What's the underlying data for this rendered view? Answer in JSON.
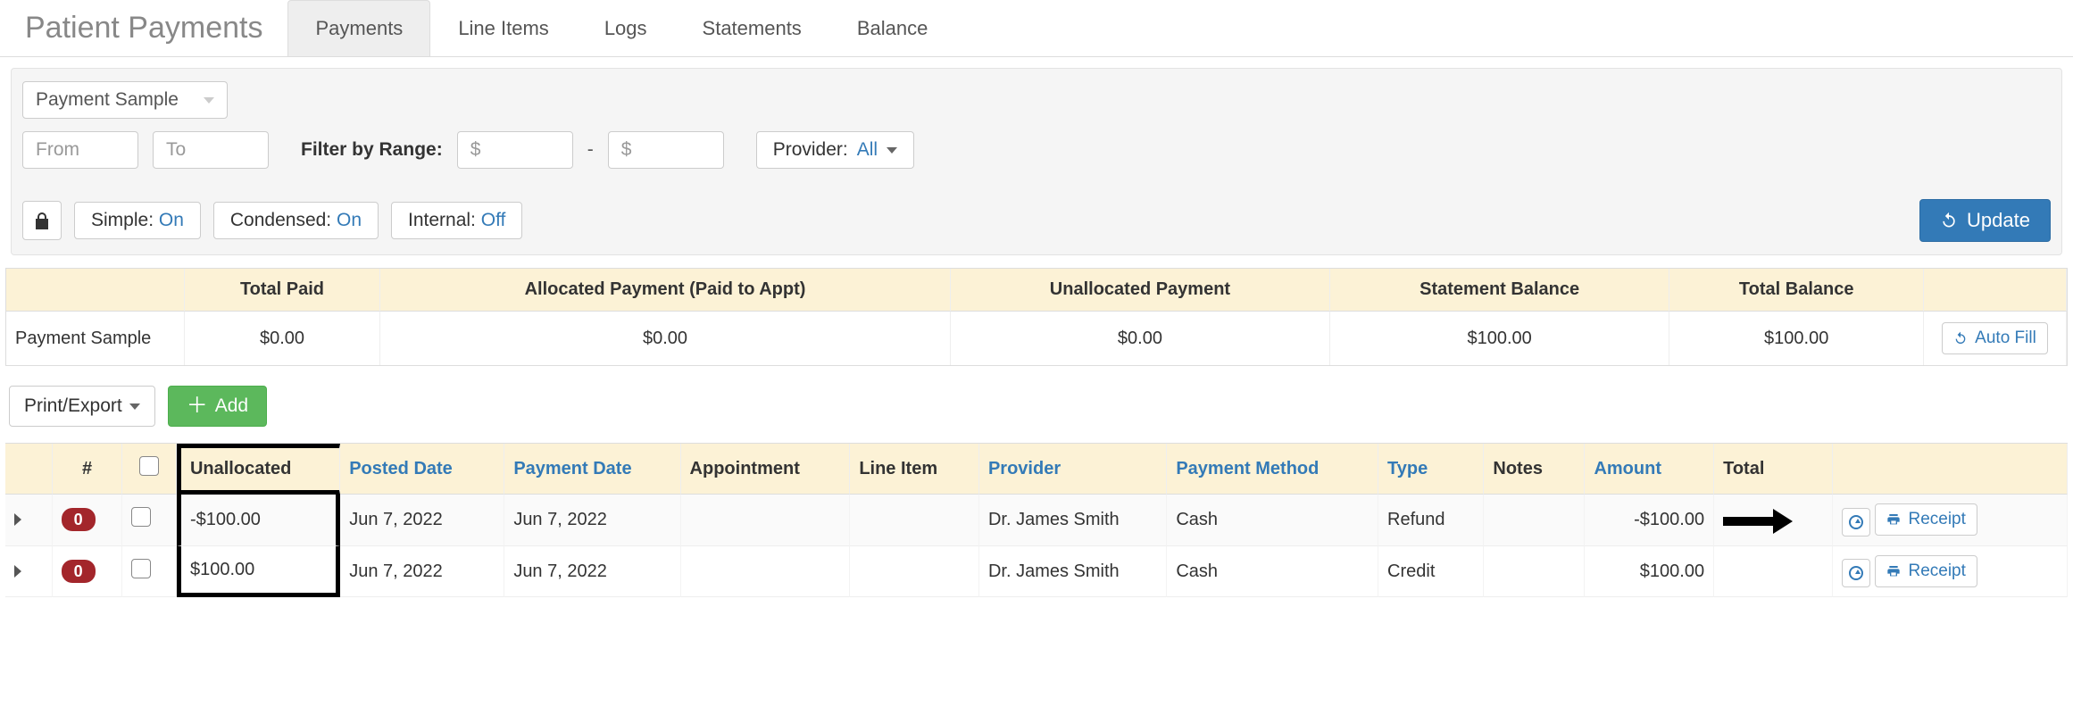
{
  "header": {
    "title": "Patient Payments",
    "tabs": [
      "Payments",
      "Line Items",
      "Logs",
      "Statements",
      "Balance"
    ],
    "active_tab": 0
  },
  "filters": {
    "payment_dropdown": "Payment Sample",
    "from_placeholder": "From",
    "to_placeholder": "To",
    "filter_by_range_label": "Filter by Range:",
    "range_min_placeholder": "$",
    "range_max_placeholder": "$",
    "range_sep": "-",
    "provider_label": "Provider:",
    "provider_value": "All",
    "toggles": {
      "simple": {
        "label": "Simple:",
        "value": "On"
      },
      "condensed": {
        "label": "Condensed:",
        "value": "On"
      },
      "internal": {
        "label": "Internal:",
        "value": "Off"
      }
    },
    "update_label": "Update"
  },
  "summary": {
    "headers": [
      "",
      "Total Paid",
      "Allocated Payment (Paid to Appt)",
      "Unallocated Payment",
      "Statement Balance",
      "Total Balance",
      ""
    ],
    "row": {
      "name": "Payment Sample",
      "total_paid": "$0.00",
      "allocated": "$0.00",
      "unallocated": "$0.00",
      "statement_balance": "$100.00",
      "total_balance": "$100.00",
      "autofill_label": "Auto Fill"
    }
  },
  "actions": {
    "print_export": "Print/Export",
    "add": "Add"
  },
  "table": {
    "headers": {
      "hash": "#",
      "unallocated": "Unallocated",
      "posted_date": "Posted Date",
      "payment_date": "Payment Date",
      "appointment": "Appointment",
      "line_item": "Line Item",
      "provider": "Provider",
      "payment_method": "Payment Method",
      "type": "Type",
      "notes": "Notes",
      "amount": "Amount",
      "total": "Total"
    },
    "rows": [
      {
        "badge": "0",
        "unallocated": "-$100.00",
        "posted_date": "Jun 7, 2022",
        "payment_date": "Jun 7, 2022",
        "appointment": "",
        "line_item": "",
        "provider": "Dr. James Smith",
        "payment_method": "Cash",
        "type": "Refund",
        "notes": "",
        "amount": "-$100.00",
        "total": "",
        "receipt_label": "Receipt"
      },
      {
        "badge": "0",
        "unallocated": "$100.00",
        "posted_date": "Jun 7, 2022",
        "payment_date": "Jun 7, 2022",
        "appointment": "",
        "line_item": "",
        "provider": "Dr. James Smith",
        "payment_method": "Cash",
        "type": "Credit",
        "notes": "",
        "amount": "$100.00",
        "total": "",
        "receipt_label": "Receipt"
      }
    ]
  }
}
